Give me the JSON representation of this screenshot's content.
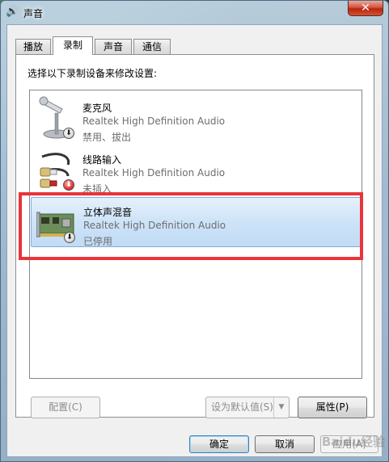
{
  "window": {
    "title": "声音",
    "app_icon": "speaker-icon",
    "close_label": "✕"
  },
  "tabs": [
    {
      "label": "播放",
      "active": false
    },
    {
      "label": "录制",
      "active": true
    },
    {
      "label": "声音",
      "active": false
    },
    {
      "label": "通信",
      "active": false
    }
  ],
  "panel": {
    "instruction": "选择以下录制设备来修改设置:"
  },
  "devices": [
    {
      "name": "麦克风",
      "driver": "Realtek High Definition Audio",
      "status": "禁用、拔出",
      "icon": "microphone-icon",
      "badge": "down-arrow-icon",
      "selected": false
    },
    {
      "name": "线路输入",
      "driver": "Realtek High Definition Audio",
      "status": "未插入",
      "icon": "line-in-cable-icon",
      "badge": "down-arrow-icon",
      "selected": false
    },
    {
      "name": "立体声混音",
      "driver": "Realtek High Definition Audio",
      "status": "已停用",
      "icon": "sound-card-icon",
      "badge": "down-arrow-icon",
      "selected": true
    }
  ],
  "buttons": {
    "configure": "配置(C)",
    "set_default": "设为默认值(S)",
    "properties": "属性(P)",
    "ok": "确定",
    "cancel": "取消",
    "apply": "应用(A)"
  },
  "colors": {
    "selection": "#cde3f8",
    "highlight_box": "#e8343a",
    "close_button": "#c8391f"
  },
  "watermark": "Baidu经验"
}
